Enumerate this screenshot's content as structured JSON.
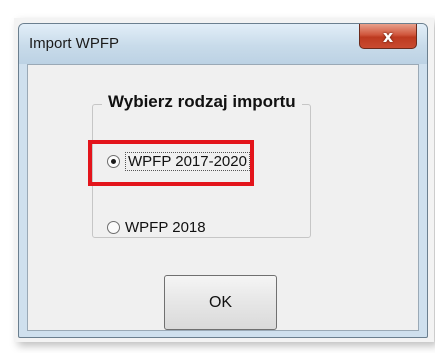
{
  "window": {
    "title": "Import WPFP",
    "close_glyph": "x"
  },
  "group": {
    "label": "Wybierz rodzaj importu"
  },
  "options": [
    {
      "label": "WPFP 2017-2020",
      "selected": true
    },
    {
      "label": "WPFP 2018",
      "selected": false
    }
  ],
  "buttons": {
    "ok_label": "OK"
  },
  "colors": {
    "highlight": "#e3141b",
    "close_button": "#c94a30"
  }
}
